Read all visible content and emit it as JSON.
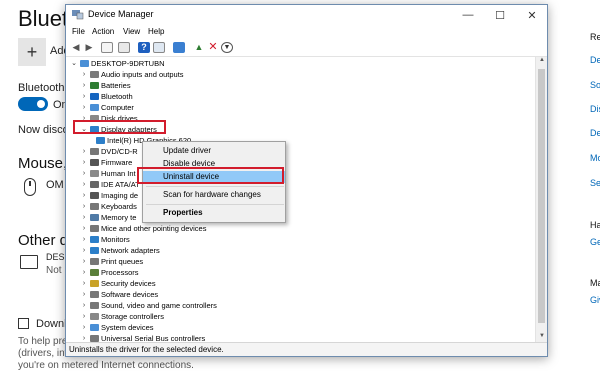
{
  "settings_page": {
    "heading": "Blueto",
    "add_label": "Add",
    "bluetooth_label": "Bluetooth",
    "toggle_state": "On",
    "discover_text": "Now discov",
    "mouse_heading": "Mouse, k",
    "mouse_item": "OM",
    "other_heading": "Other de",
    "other_item_name": "DESI",
    "other_item_status": "Not",
    "download_checkbox": "Downlo",
    "help_line1": "To help pre",
    "help_line2": "(drivers, info",
    "help_line3": "you're on metered Internet connections.",
    "right_panel": {
      "heading1": "Re",
      "links1": [
        "De",
        "So",
        "Dis",
        "De",
        "Mo",
        "Se"
      ],
      "heading2": "Ha",
      "link2": "Ge",
      "heading3": "Ma",
      "link3": "Giv"
    }
  },
  "window": {
    "title": "Device Manager",
    "controls": {
      "minimize": "—",
      "maximize": "☐",
      "close": "✕"
    },
    "menu": [
      "File",
      "Action",
      "View",
      "Help"
    ],
    "toolbar_icons": [
      "back-arrow",
      "forward-arrow",
      "properties",
      "show-hidden",
      "help",
      "update-driver",
      "display-monitor",
      "enable-device",
      "uninstall-x",
      "download"
    ],
    "root_node": "DESKTOP-9DRTUBN",
    "tree": [
      {
        "label": "Audio inputs and outputs",
        "icon": "speaker-icon",
        "color": "#7a7a7a"
      },
      {
        "label": "Batteries",
        "icon": "battery-icon",
        "color": "#2e7d32"
      },
      {
        "label": "Bluetooth",
        "icon": "bluetooth-icon",
        "color": "#1565c0"
      },
      {
        "label": "Computer",
        "icon": "computer-icon",
        "color": "#4a8fd6"
      },
      {
        "label": "Disk drives",
        "icon": "disk-icon",
        "color": "#888888"
      },
      {
        "label": "Display adapters",
        "icon": "display-icon",
        "color": "#2c7fc9",
        "expanded": true
      },
      {
        "label": "Intel(R) HD Graphics 620",
        "icon": "display-icon",
        "color": "#2c7fc9",
        "child": true
      },
      {
        "label": "DVD/CD-R",
        "icon": "dvd-icon",
        "color": "#777777"
      },
      {
        "label": "Firmware",
        "icon": "firmware-icon",
        "color": "#555555"
      },
      {
        "label": "Human Int",
        "icon": "hid-icon",
        "color": "#8a8a8a"
      },
      {
        "label": "IDE ATA/AT",
        "icon": "ide-icon",
        "color": "#666666"
      },
      {
        "label": "Imaging de",
        "icon": "camera-icon",
        "color": "#555555"
      },
      {
        "label": "Keyboards",
        "icon": "keyboard-icon",
        "color": "#777777"
      },
      {
        "label": "Memory te",
        "icon": "memory-icon",
        "color": "#4f7aa6"
      },
      {
        "label": "Mice and other pointing devices",
        "icon": "mouse-icon",
        "color": "#777777"
      },
      {
        "label": "Monitors",
        "icon": "monitor-icon",
        "color": "#2c7fc9"
      },
      {
        "label": "Network adapters",
        "icon": "network-icon",
        "color": "#2c7fc9"
      },
      {
        "label": "Print queues",
        "icon": "printer-icon",
        "color": "#777777"
      },
      {
        "label": "Processors",
        "icon": "processor-icon",
        "color": "#5a7f3a"
      },
      {
        "label": "Security devices",
        "icon": "security-icon",
        "color": "#c9a227"
      },
      {
        "label": "Software devices",
        "icon": "software-icon",
        "color": "#777777"
      },
      {
        "label": "Sound, video and game controllers",
        "icon": "sound-icon",
        "color": "#777777"
      },
      {
        "label": "Storage controllers",
        "icon": "storage-icon",
        "color": "#888888"
      },
      {
        "label": "System devices",
        "icon": "system-icon",
        "color": "#4a8fd6"
      },
      {
        "label": "Universal Serial Bus controllers",
        "icon": "usb-icon",
        "color": "#777777"
      }
    ],
    "status": "Uninstalls the driver for the selected device."
  },
  "context_menu": {
    "items": [
      "Update driver",
      "Disable device",
      "Uninstall device",
      "Scan for hardware changes",
      "Properties"
    ],
    "highlighted": "Uninstall device"
  },
  "colors": {
    "accent": "#0067b8",
    "highlight_box": "#d21c2c",
    "menu_hover": "#91c9f7"
  }
}
